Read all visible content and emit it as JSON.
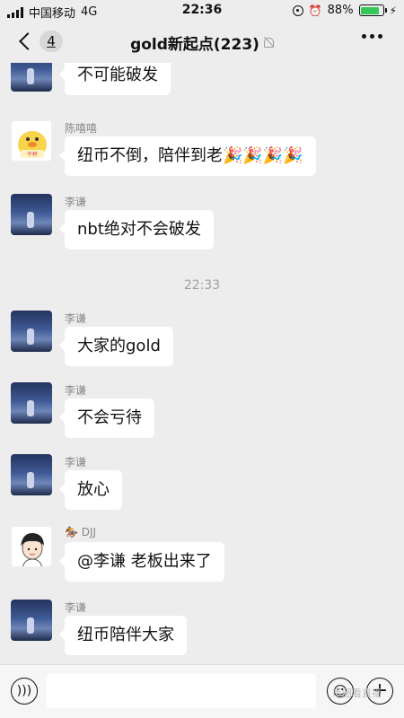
{
  "status_bar": {
    "carrier": "中国移动",
    "network": "4G",
    "time": "22:36",
    "battery_percent": "88%",
    "battery_level": 0.88
  },
  "header": {
    "back_badge": "4",
    "title": "gold新起点(223)"
  },
  "messages": [
    {
      "sender": "",
      "text": "不可能破发",
      "avatar": "sky-avatar"
    },
    {
      "sender": "陈嘻嘻",
      "text": "纽币不倒，陪伴到老🎉🎉🎉🎉",
      "avatar": "duck-avatar"
    },
    {
      "sender": "李谦",
      "text": "nbt绝对不会破发",
      "avatar": "sky-avatar"
    },
    {
      "sender": "李谦",
      "text": "大家的gold",
      "avatar": "sky-avatar"
    },
    {
      "sender": "李谦",
      "text": "不会亏待",
      "avatar": "sky-avatar"
    },
    {
      "sender": "李谦",
      "text": "放心",
      "avatar": "sky-avatar"
    },
    {
      "sender": "DJJ",
      "text": "@李谦 老板出来了",
      "avatar": "person-avatar"
    },
    {
      "sender": "李谦",
      "text": "纽币陪伴大家",
      "avatar": "sky-avatar"
    }
  ],
  "time_separator": "22:33",
  "duck_avatar_label": "干杯",
  "input": {
    "placeholder": ""
  },
  "watermark": "币圈看直播"
}
